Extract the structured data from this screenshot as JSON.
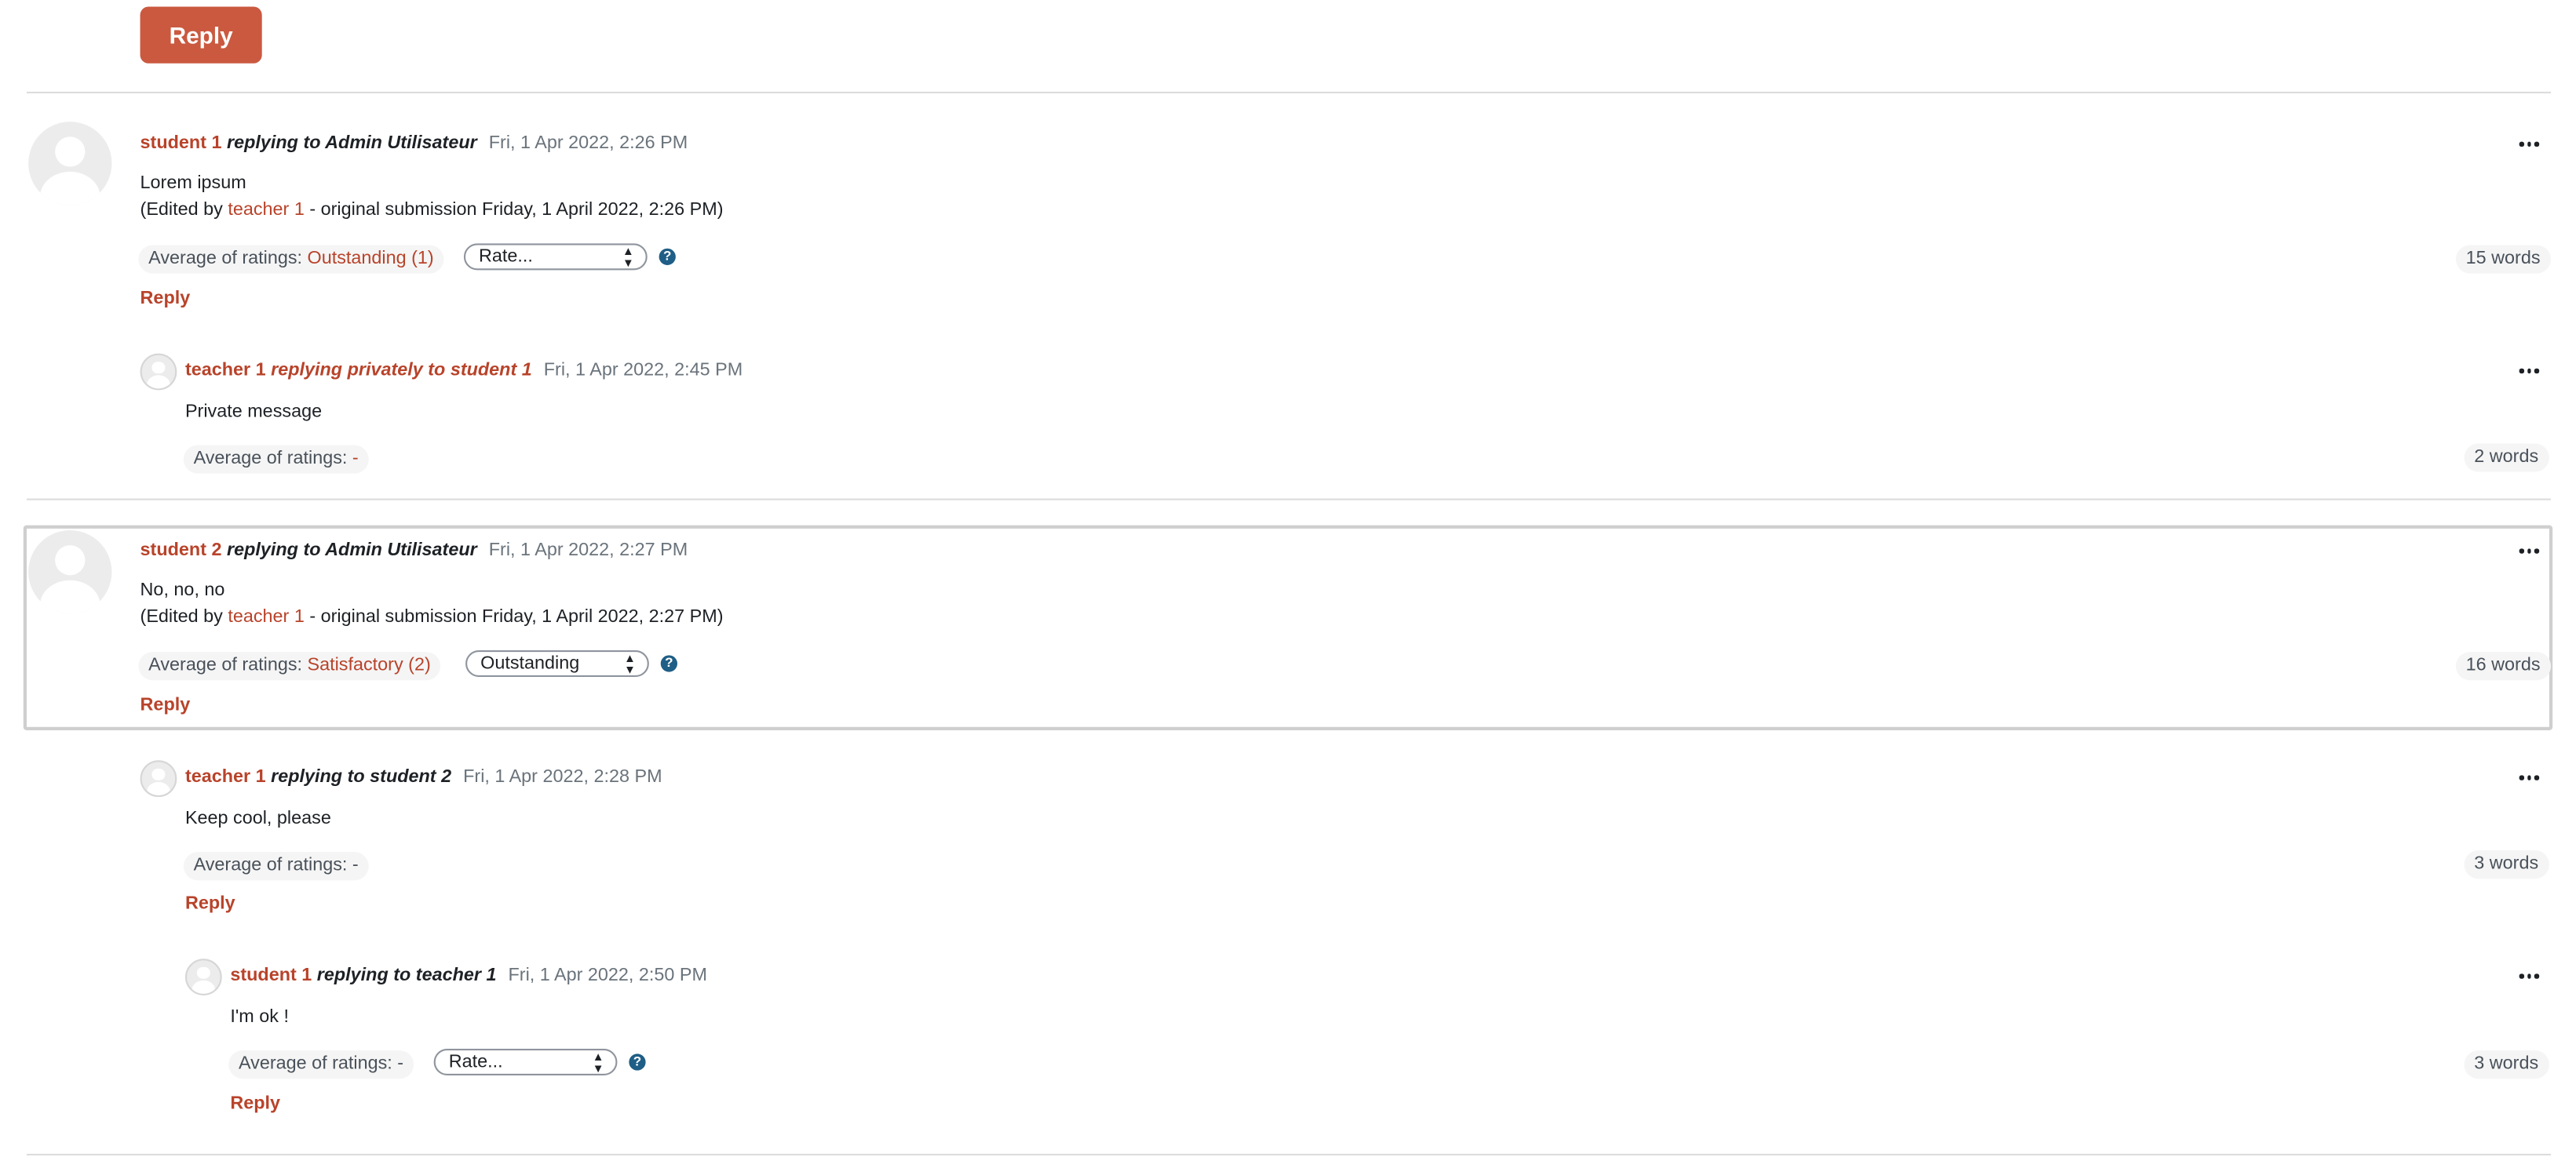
{
  "top_reply_label": "Reply",
  "icons": {
    "menu": "more-actions-icon",
    "help": "help-icon",
    "avatar": "user-avatar-icon",
    "select_arrow": "sort-arrows-icon"
  },
  "colors": {
    "accent": "#ca5940",
    "link": "#b8432a",
    "help": "#1f5e86"
  },
  "posts": [
    {
      "author": "student 1",
      "replying": "replying to Admin Utilisateur",
      "date": "Fri, 1 Apr 2022, 2:26 PM",
      "message": "Lorem ipsum",
      "edited_prefix": "(Edited by ",
      "edited_by": "teacher 1",
      "edited_suffix": " - original submission Friday, 1 April 2022, 2:26 PM)",
      "avg_label": "Average of ratings: ",
      "avg_value": "Outstanding (1)",
      "select_value": "Rate...",
      "reply_label": "Reply",
      "words": "15 words"
    },
    {
      "author": "teacher 1",
      "replying": "replying privately to student 1",
      "date": "Fri, 1 Apr 2022, 2:45 PM",
      "message": "Private message",
      "avg_label": "Average of ratings: ",
      "avg_value": "-",
      "words": "2 words"
    },
    {
      "author": "student 2",
      "replying": "replying to Admin Utilisateur",
      "date": "Fri, 1 Apr 2022, 2:27 PM",
      "message": "No, no, no",
      "edited_prefix": "(Edited by ",
      "edited_by": "teacher 1",
      "edited_suffix": " - original submission Friday, 1 April 2022, 2:27 PM)",
      "avg_label": "Average of ratings: ",
      "avg_value": "Satisfactory (2)",
      "select_value": "Outstanding",
      "reply_label": "Reply",
      "words": "16 words"
    },
    {
      "author": "teacher 1",
      "replying": "replying to student 2",
      "date": "Fri, 1 Apr 2022, 2:28 PM",
      "message": "Keep cool, please",
      "avg_label": "Average of ratings: -",
      "reply_label": "Reply",
      "words": "3 words"
    },
    {
      "author": "student 1",
      "replying": "replying to teacher 1",
      "date": "Fri, 1 Apr 2022, 2:50 PM",
      "message": "I'm ok !",
      "avg_label": "Average of ratings: -",
      "select_value": "Rate...",
      "reply_label": "Reply",
      "words": "3 words"
    }
  ]
}
